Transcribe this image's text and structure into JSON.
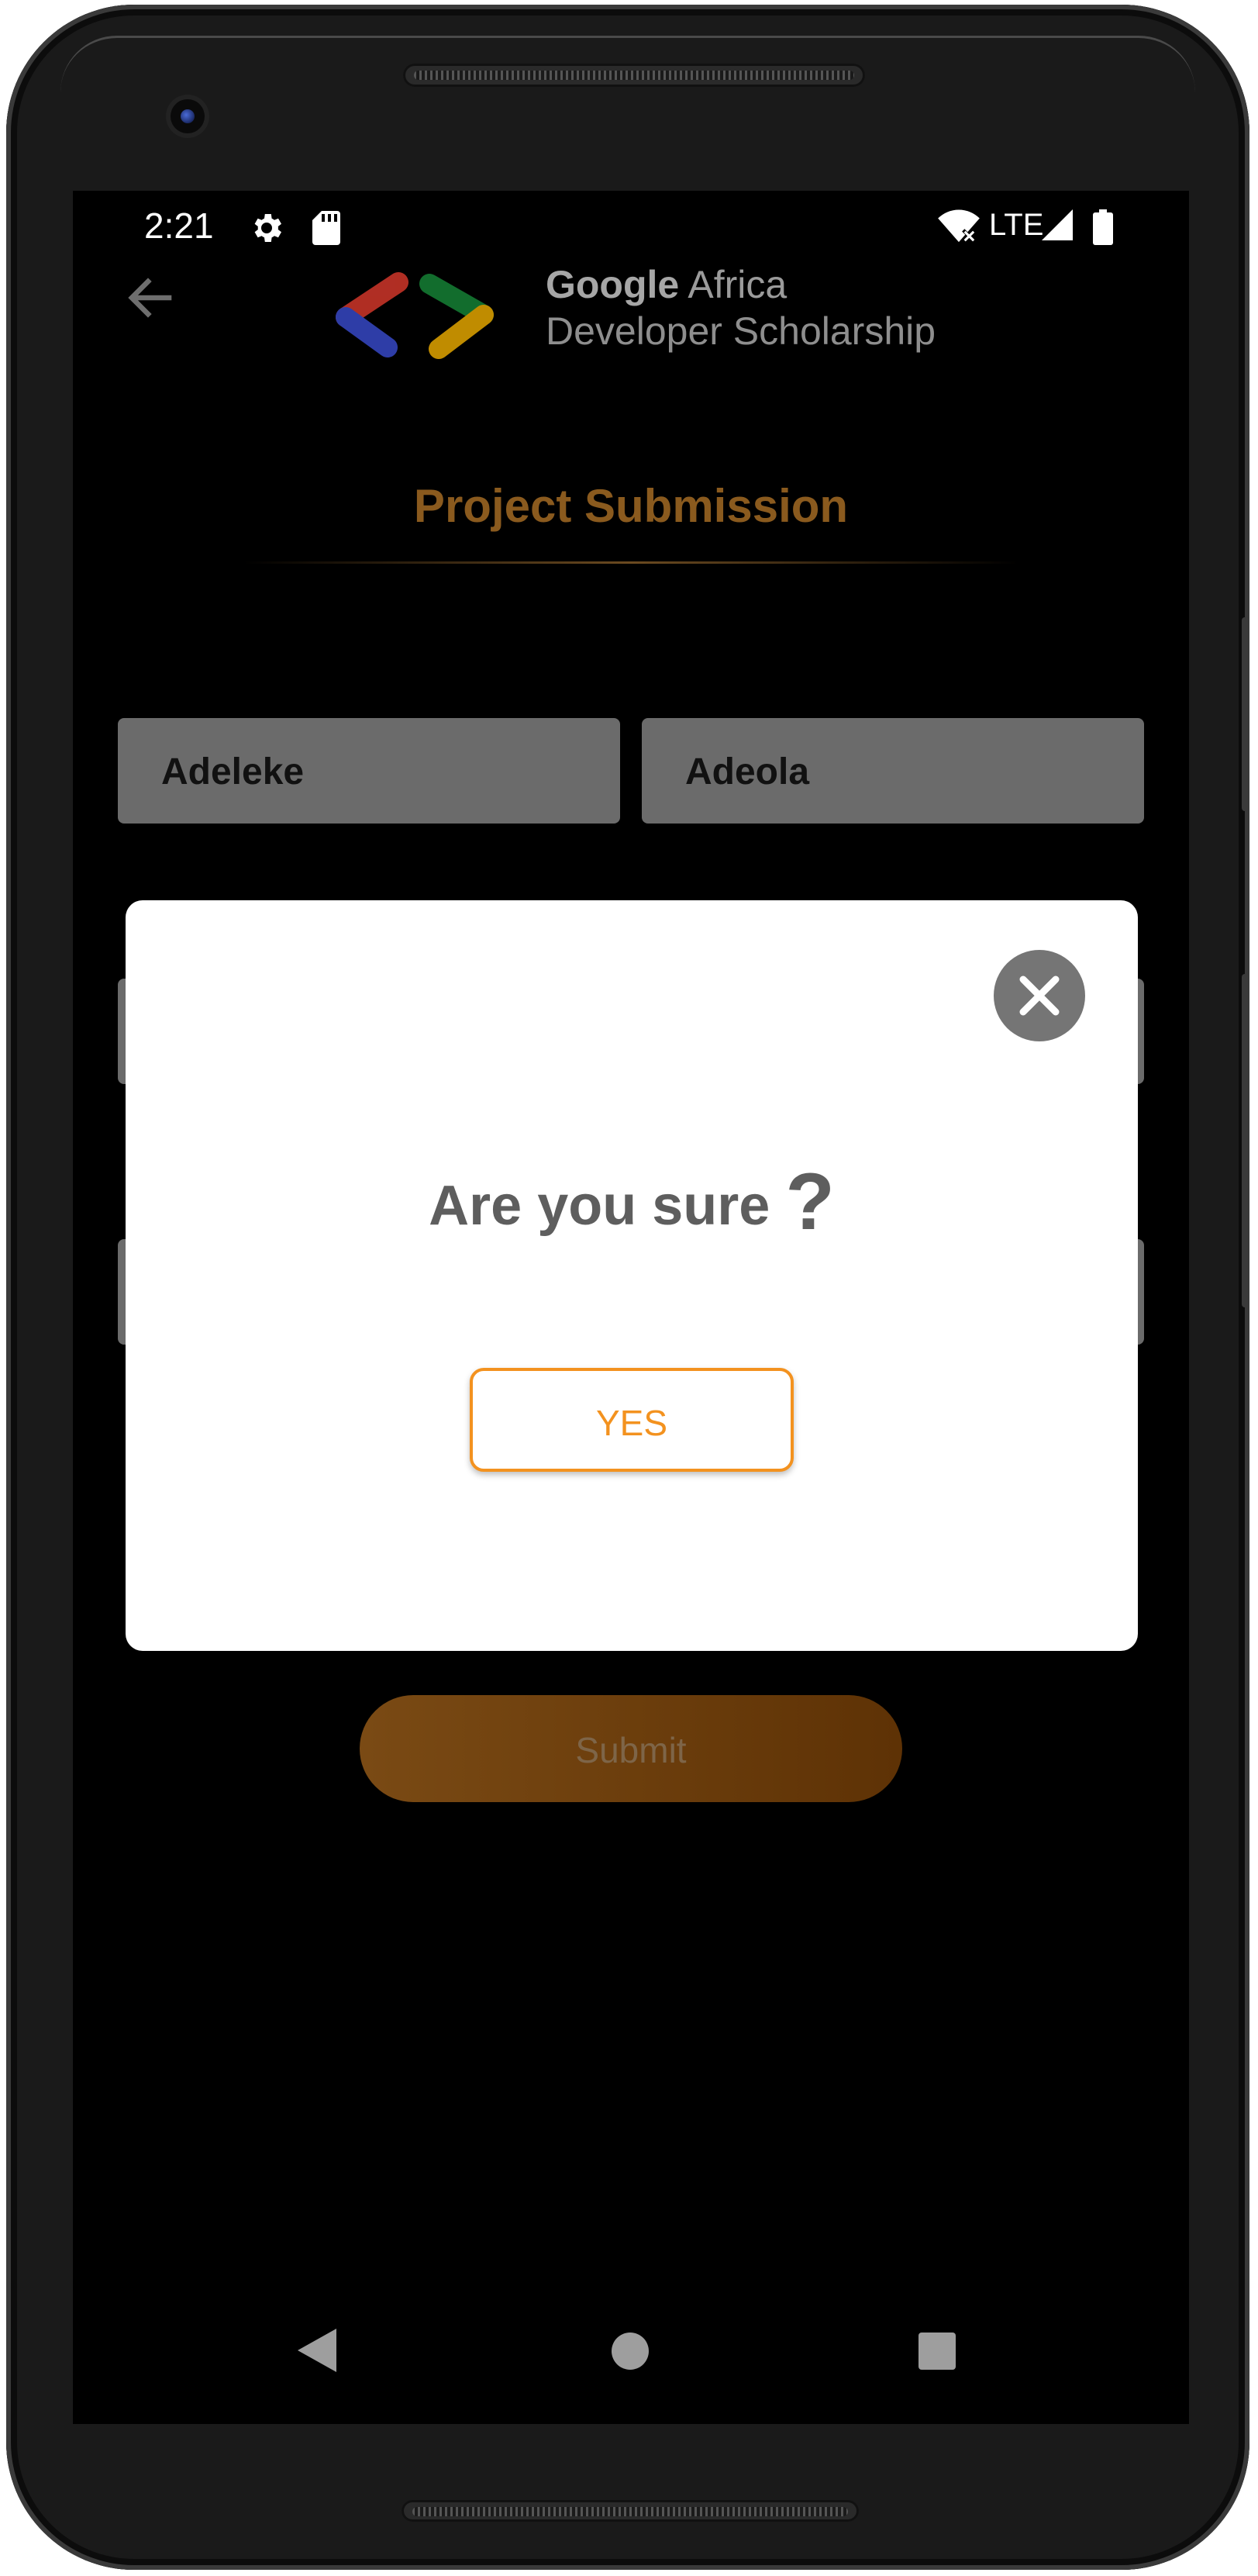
{
  "status_bar": {
    "time": "2:21",
    "network": "LTE",
    "icons": [
      "settings-icon",
      "sd-card-icon",
      "wifi-icon",
      "signal-icon",
      "battery-icon"
    ]
  },
  "header": {
    "brand_bold": "Google",
    "brand_rest": " Africa",
    "brand_line2": "Developer Scholarship",
    "logo_colors": [
      "#3b4fd6",
      "#e23b2e",
      "#188c3a",
      "#f6b400"
    ]
  },
  "page": {
    "title": "Project Submission"
  },
  "form": {
    "first_name_value": "Adeleke",
    "last_name_value": "Adeola",
    "submit_label": "Submit"
  },
  "dialog": {
    "message": "Are you sure",
    "message_mark": "?",
    "confirm_label": "YES"
  },
  "colors": {
    "accent_orange": "#f3921f",
    "title_brown": "#8a5a1e",
    "dialog_text": "#5e5e5e"
  }
}
